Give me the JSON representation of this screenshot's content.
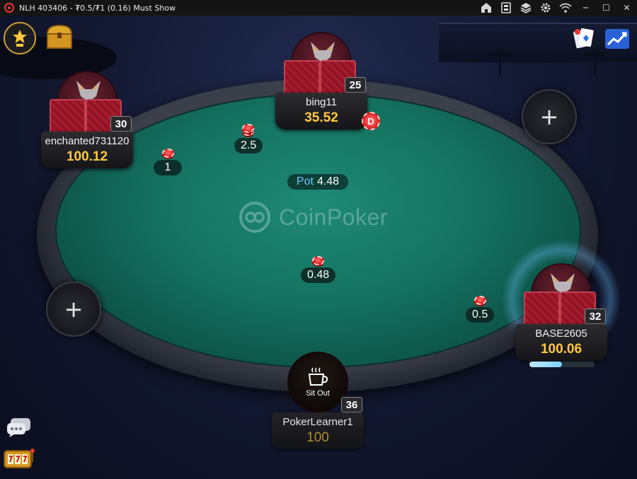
{
  "window": {
    "title": "NLH 403406 - ₮0.5/₮1 (0.16) Must Show",
    "controls": {
      "minimize": "─",
      "maximize": "☐",
      "close": "✕"
    }
  },
  "table": {
    "brand": "CoinPoker",
    "pot": {
      "label": "Pot",
      "amount": "4.48"
    },
    "bets": [
      {
        "amount": "2.5"
      },
      {
        "amount": "1"
      },
      {
        "amount": "0.48"
      },
      {
        "amount": "0.5"
      }
    ]
  },
  "players": {
    "bing11": {
      "name": "bing11",
      "chips": "35.52",
      "badge": "25"
    },
    "enchanted": {
      "name": "enchanted731120",
      "chips": "100.12",
      "badge": "30"
    },
    "base": {
      "name": "BASE2605",
      "chips": "100.06",
      "badge": "32",
      "timer_fraction": 0.5
    },
    "hero": {
      "name": "PokerLearner1",
      "chips": "100",
      "badge": "36",
      "status": "Sit Out"
    }
  },
  "dealer": {
    "label": "D"
  },
  "empty_seats": {
    "plus": "+"
  },
  "colors": {
    "accent": "#ffc83d",
    "pot_label": "#6cc5ff",
    "felt": "#14705f"
  }
}
